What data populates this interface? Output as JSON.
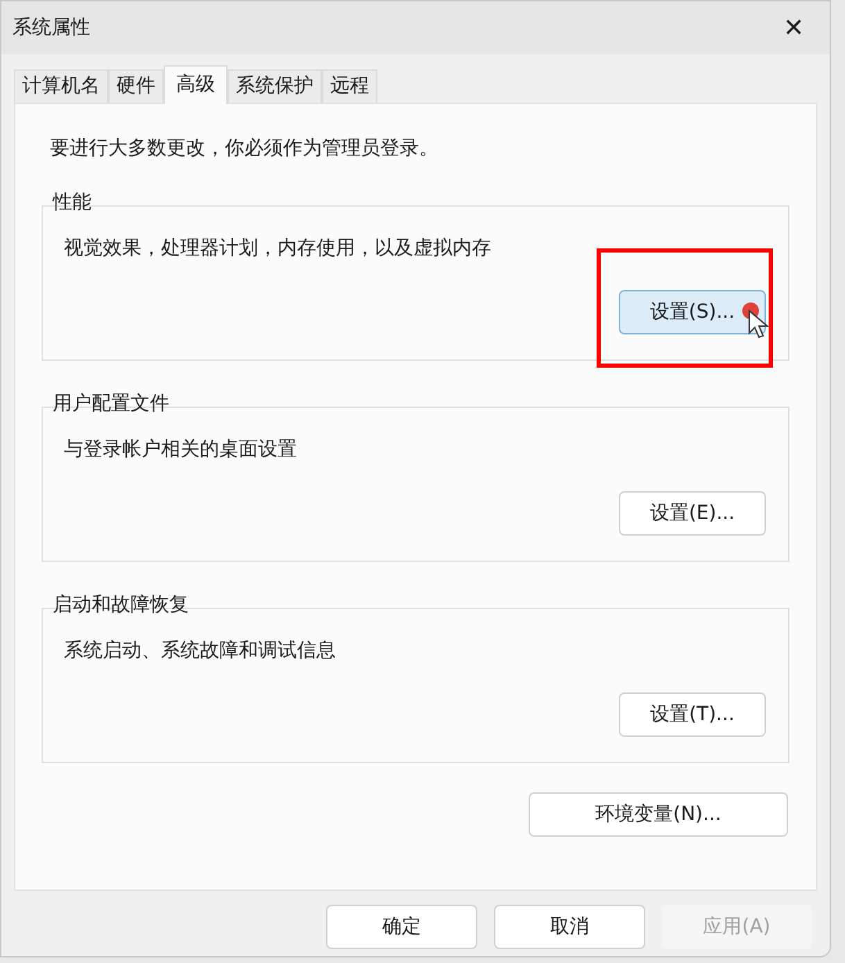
{
  "window": {
    "title": "系统属性",
    "close": "✕"
  },
  "tabs": [
    {
      "label": "计算机名",
      "selected": false
    },
    {
      "label": "硬件",
      "selected": false
    },
    {
      "label": "高级",
      "selected": true
    },
    {
      "label": "系统保护",
      "selected": false
    },
    {
      "label": "远程",
      "selected": false
    }
  ],
  "notice": "要进行大多数更改，你必须作为管理员登录。",
  "groups": [
    {
      "title": "性能",
      "description": "视觉效果，处理器计划，内存使用，以及虚拟内存",
      "button": {
        "label": "设置(S)...",
        "hovered": true,
        "highlighted": true
      }
    },
    {
      "title": "用户配置文件",
      "description": "与登录帐户相关的桌面设置",
      "button": {
        "label": "设置(E)...",
        "hovered": false,
        "highlighted": false
      }
    },
    {
      "title": "启动和故障恢复",
      "description": "系统启动、系统故障和调试信息",
      "button": {
        "label": "设置(T)...",
        "hovered": false,
        "highlighted": false
      }
    }
  ],
  "env_button": "环境变量(N)...",
  "footer_buttons": [
    {
      "label": "确定",
      "disabled": false
    },
    {
      "label": "取消",
      "disabled": false
    },
    {
      "label": "应用(A)",
      "disabled": true
    }
  ]
}
